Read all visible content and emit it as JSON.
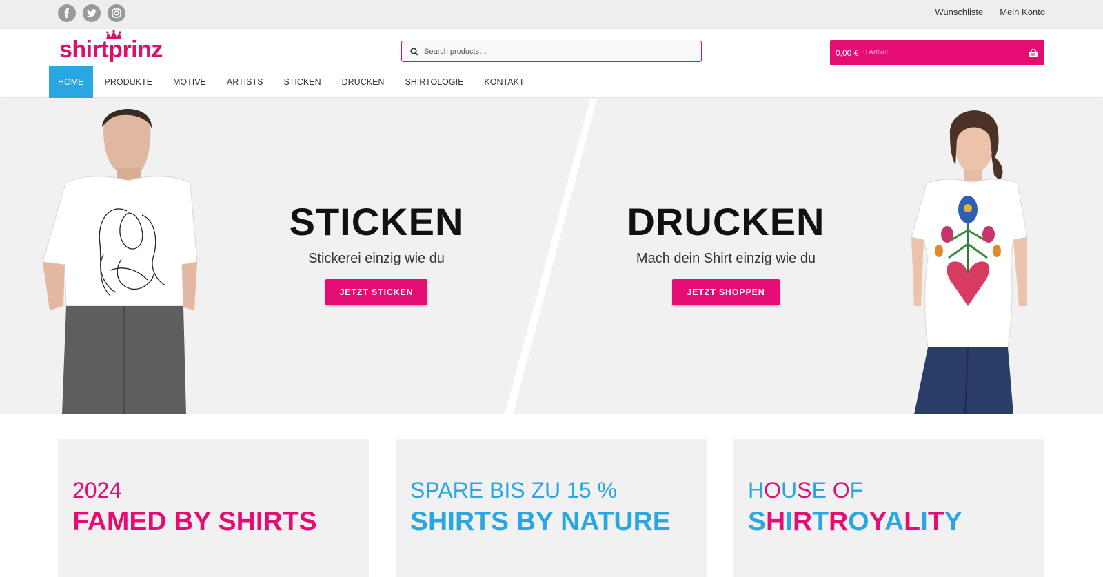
{
  "topbar": {
    "social": [
      "facebook-icon",
      "twitter-icon",
      "instagram-icon"
    ],
    "links": [
      "Wunschliste",
      "Mein Konto"
    ]
  },
  "header": {
    "logo_text": "shirtprinz",
    "search_placeholder": "Search products…",
    "cart": {
      "price": "0,00 €",
      "count": "0 Artikel",
      "icon": "basket-icon"
    },
    "nav": [
      "HOME",
      "PRODUKTE",
      "MOTIVE",
      "ARTISTS",
      "STICKEN",
      "DRUCKEN",
      "SHIRTOLOGIE",
      "KONTAKT"
    ],
    "nav_active": "HOME"
  },
  "hero": {
    "left": {
      "title": "STICKEN",
      "subtitle": "Stickerei einzig wie du",
      "button": "JETZT STICKEN"
    },
    "right": {
      "title": "DRUCKEN",
      "subtitle": "Mach dein Shirt einzig wie du",
      "button": "JETZT SHOPPEN"
    }
  },
  "cards": [
    {
      "line1": "2024",
      "line2": "FAMED BY SHIRTS"
    },
    {
      "line1": "SPARE BIS ZU 15 %",
      "line2": "SHIRTS BY NATURE"
    },
    {
      "line1": "HOUSE OF",
      "line2": "SHIRTROYALITY"
    }
  ],
  "colors": {
    "brand_pink": "#e50d73",
    "accent_blue": "#2aa6e0",
    "hero_bg": "#f1f1f1"
  }
}
